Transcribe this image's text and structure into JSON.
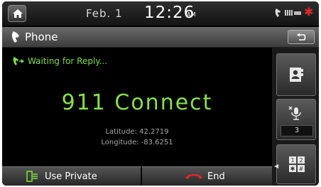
{
  "status_bar": {
    "date": "Feb.  1",
    "time": "12:26",
    "ampm": "AM"
  },
  "title_bar": {
    "title": "Phone"
  },
  "call": {
    "status": "Waiting for Reply...",
    "callee": "911 Connect",
    "latitude": "Latitude: 42.2719",
    "longitude": "Longitude: -83.6251"
  },
  "buttons": {
    "use_private": "Use Private",
    "end": "End"
  },
  "side_panel": {
    "mute_level": "3"
  },
  "colors": {
    "accent_green": "#86e04a",
    "end_red": "#e0262a"
  }
}
